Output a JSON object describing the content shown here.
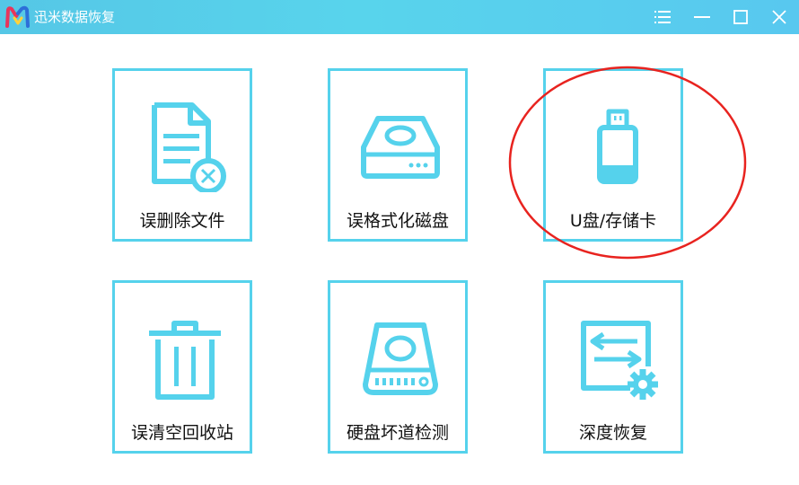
{
  "app": {
    "title": "迅米数据恢复",
    "accent_color": "#55d2ec",
    "titlebar_color": "#58d0ec"
  },
  "window_controls": [
    {
      "name": "menu",
      "icon": "menu-icon"
    },
    {
      "name": "minimize",
      "icon": "minimize-icon"
    },
    {
      "name": "maximize",
      "icon": "maximize-icon"
    },
    {
      "name": "close",
      "icon": "close-icon"
    }
  ],
  "tiles": [
    {
      "label": "误删除文件",
      "icon": "deleted-file-icon"
    },
    {
      "label": "误格式化磁盘",
      "icon": "disk-icon"
    },
    {
      "label": "U盘/存储卡",
      "icon": "usb-drive-icon"
    },
    {
      "label": "误清空回收站",
      "icon": "trash-bin-icon"
    },
    {
      "label": "硬盘坏道检测",
      "icon": "hard-drive-icon"
    },
    {
      "label": "深度恢复",
      "icon": "deep-recovery-icon"
    }
  ],
  "annotation": {
    "shape": "ellipse",
    "color": "#e8231f",
    "target": "U盘/存储卡"
  }
}
